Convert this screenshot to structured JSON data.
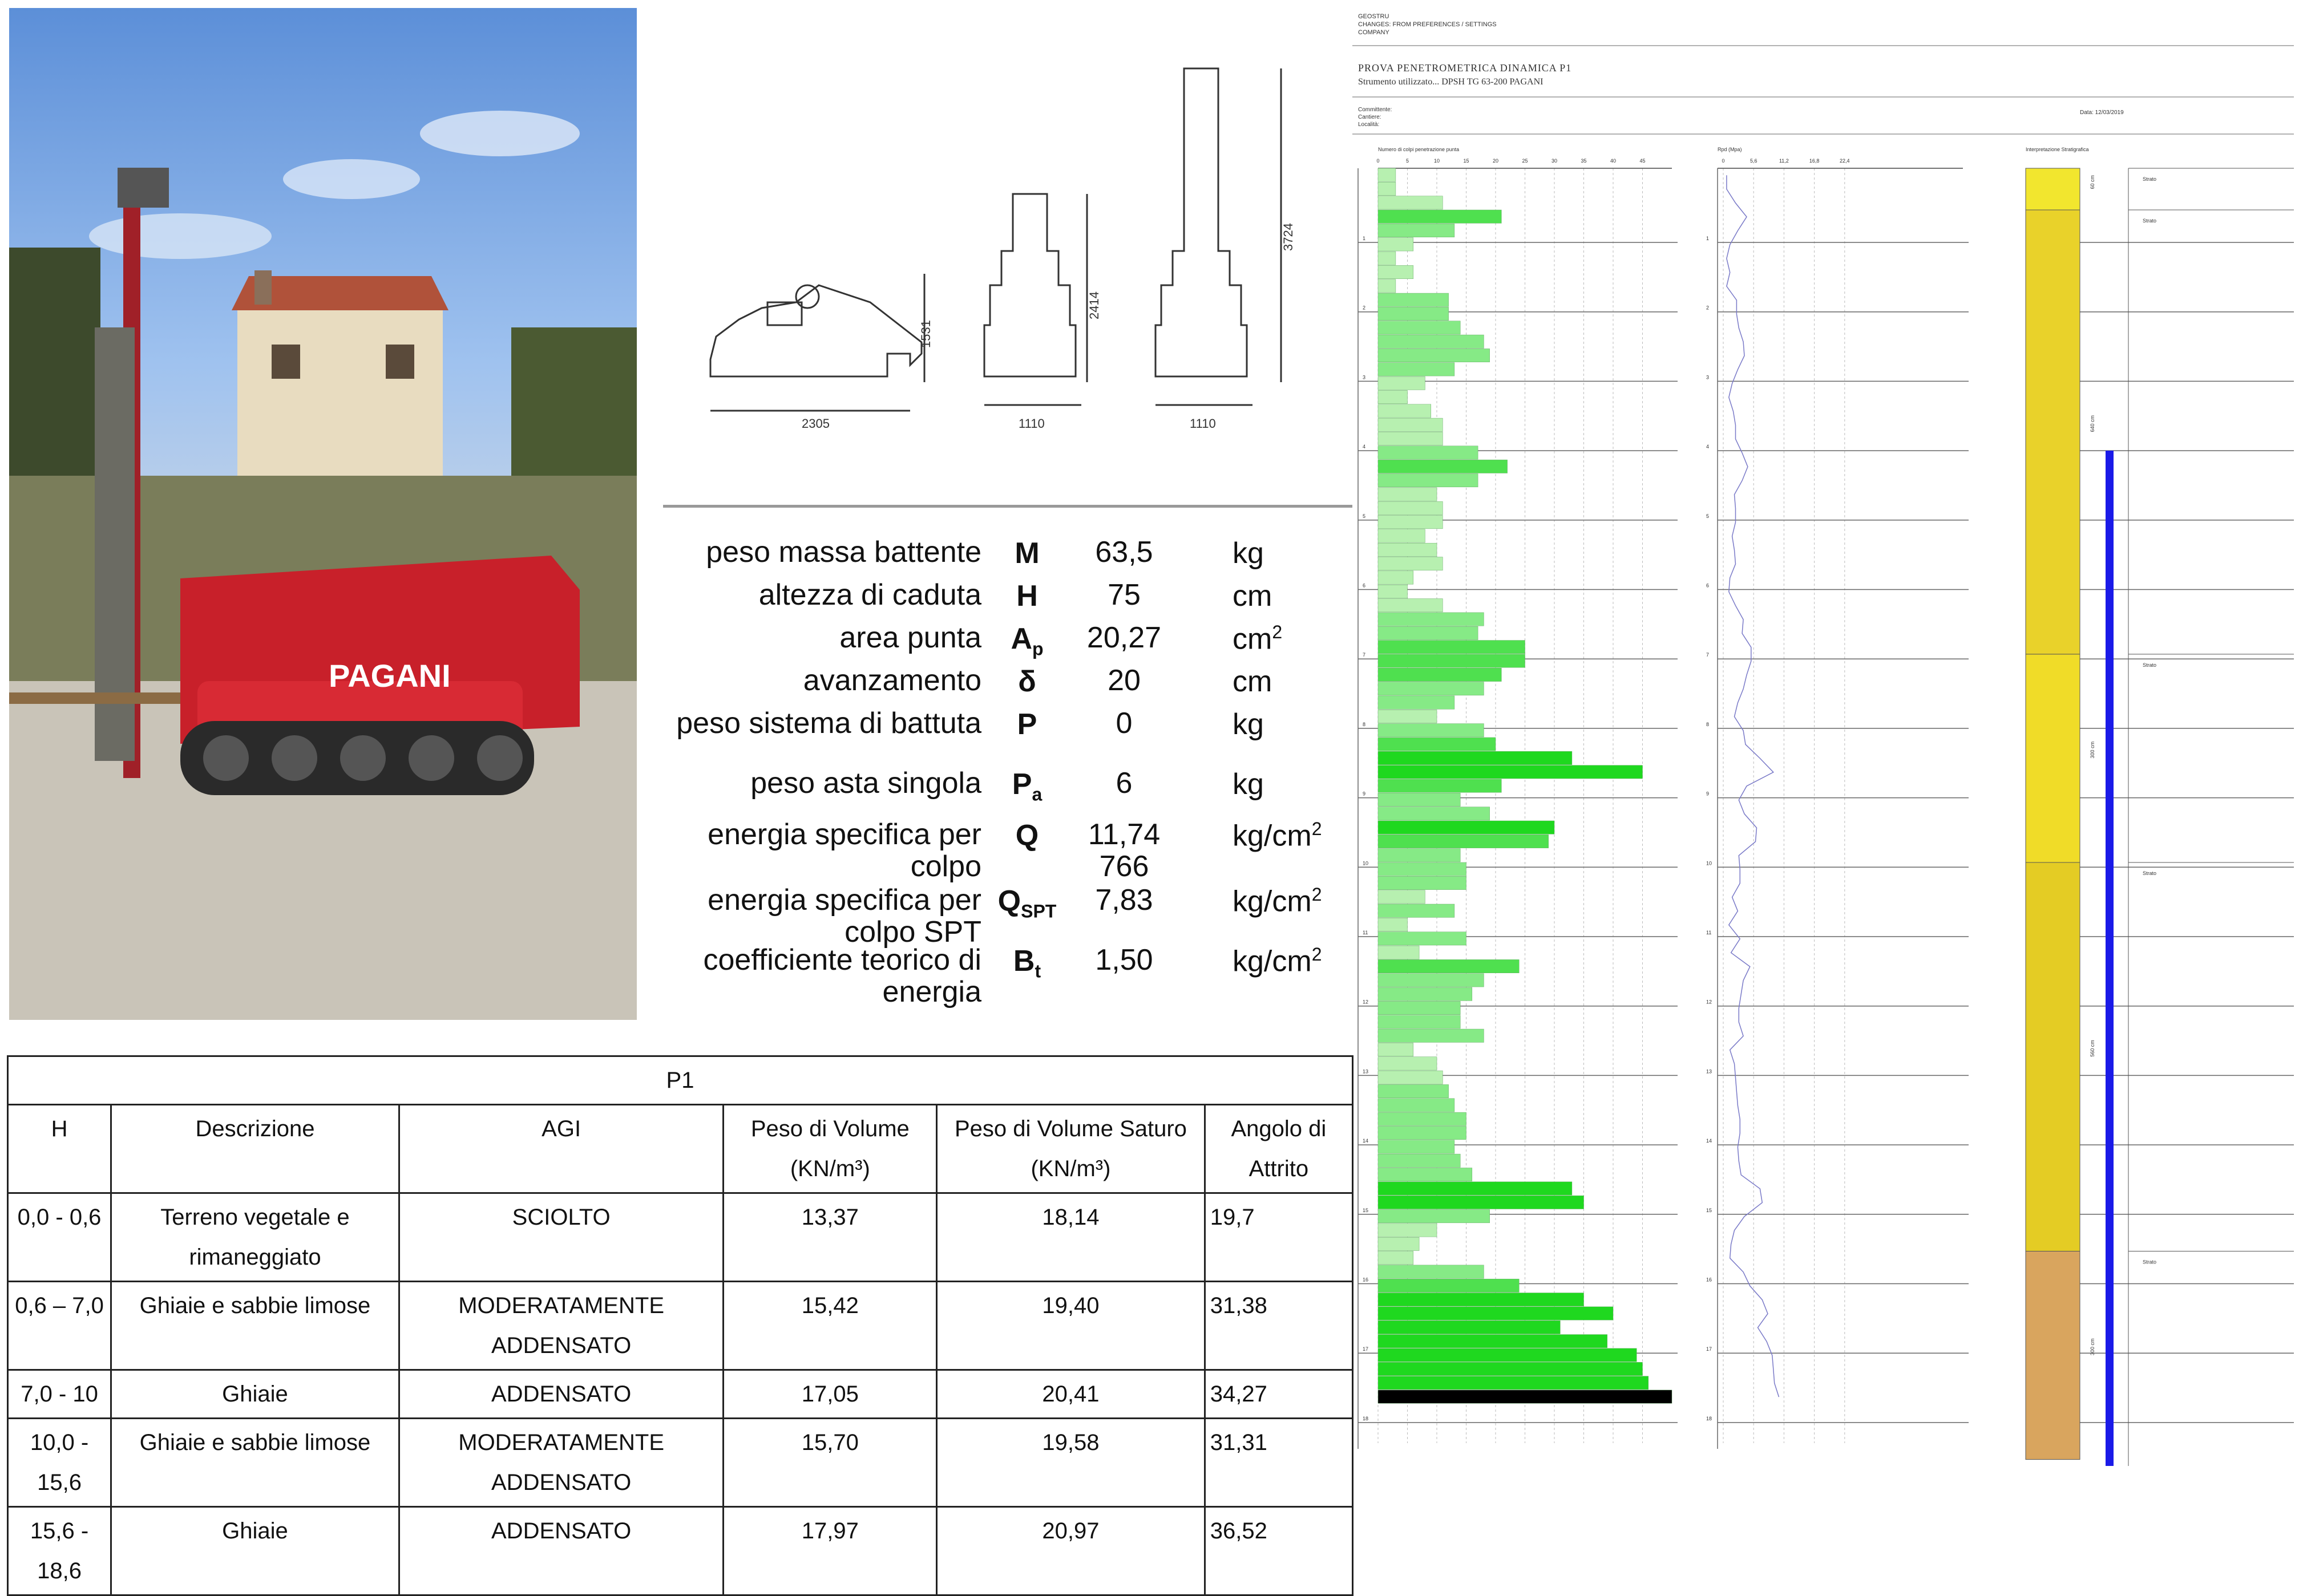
{
  "report": {
    "company_lines": [
      "GEOSTRU",
      "CHANGES: FROM PREFERENCES / SETTINGS",
      "COMPANY"
    ],
    "test_title": "PROVA PENETROMETRICA DINAMICA P1",
    "instrument": "Strumento utilizzato... DPSH TG 63-200 PAGANI",
    "client_lines": [
      "Committente:",
      "Cantiere:",
      "Località:"
    ],
    "date": "Data: 12/03/2019",
    "col1_header": "Numero di colpi penetrazione punta",
    "col2_header": "Rpd (Mpa)",
    "col3_header": "Interpretazione Stratigrafica",
    "blow_ticks": [
      "0",
      "5",
      "10",
      "15",
      "20",
      "25",
      "30",
      "35",
      "40",
      "45"
    ],
    "rpd_ticks": [
      "0",
      "5,6",
      "11,2",
      "16,8",
      "22,4"
    ],
    "depth_ticks": [
      "1",
      "2",
      "3",
      "4",
      "5",
      "6",
      "7",
      "8",
      "9",
      "10",
      "11",
      "12",
      "13",
      "14",
      "15",
      "16",
      "17",
      "18"
    ],
    "strata_label": "Strato",
    "strata_depths": [
      "60 cm",
      "640 cm",
      "300 cm",
      "560 cm",
      "300 cm"
    ]
  },
  "drawings": {
    "dims": [
      "1531",
      "2305",
      "2414",
      "1110",
      "3724",
      "1110"
    ]
  },
  "spec": {
    "rows": [
      {
        "label": "peso massa battente",
        "sym": "M",
        "val": "63,5",
        "unit": "kg"
      },
      {
        "label": "altezza di caduta",
        "sym": "H",
        "val": "75",
        "unit": "cm"
      },
      {
        "label": "area punta",
        "sym": "A",
        "sub": "p",
        "val": "20,27",
        "unit": "cm",
        "sup": "2"
      },
      {
        "label": "avanzamento",
        "sym": "δ",
        "val": "20",
        "unit": "cm"
      },
      {
        "label": "peso sistema di battuta",
        "sym": "P",
        "val": "0",
        "unit": "kg"
      },
      {
        "label": "peso asta singola",
        "sym": "P",
        "sub": "a",
        "val": "6",
        "unit": "kg"
      },
      {
        "label": "energia specifica per colpo",
        "sym": "Q",
        "val": "11,74 766",
        "unit": "kg/cm",
        "sup": "2"
      },
      {
        "label": "energia specifica per colpo SPT",
        "sym": "Q",
        "sub": "SPT",
        "val": "7,83",
        "unit": "kg/cm",
        "sup": "2"
      },
      {
        "label": "coefficiente teorico di energia",
        "sym": "B",
        "sub": "t",
        "val": "1,50",
        "unit": "kg/cm",
        "sup": "2"
      }
    ]
  },
  "table": {
    "title": "P1",
    "headers": [
      "H",
      "Descrizione",
      "AGI",
      "Peso di Volume (KN/m³)",
      "Peso di Volume Saturo (KN/m³)",
      "Angolo di Attrito"
    ],
    "rows": [
      [
        "0,0 - 0,6",
        "Terreno vegetale e rimaneggiato",
        "SCIOLTO",
        "13,37",
        "18,14",
        "19,7"
      ],
      [
        "0,6 – 7,0",
        "Ghiaie e sabbie limose",
        "MODERATAMENTE ADDENSATO",
        "15,42",
        "19,40",
        "31,38"
      ],
      [
        "7,0 - 10",
        "Ghiaie",
        "ADDENSATO",
        "17,05",
        "20,41",
        "34,27"
      ],
      [
        "10,0 - 15,6",
        "Ghiaie e sabbie limose",
        "MODERATAMENTE ADDENSATO",
        "15,70",
        "19,58",
        "31,31"
      ],
      [
        "15,6 - 18,6",
        "Ghiaie",
        "ADDENSATO",
        "17,97",
        "20,97",
        "36,52"
      ]
    ]
  },
  "photo": {
    "brand": "PAGANI"
  },
  "chart_data": {
    "type": "bar",
    "title": "",
    "xlabel": "Numero di colpi penetrazione punta",
    "ylabel": "",
    "xlim": [
      0,
      50
    ],
    "depth_step_m": 0.2,
    "values": [
      3,
      3,
      11,
      21,
      13,
      6,
      3,
      6,
      3,
      12,
      12,
      14,
      18,
      19,
      13,
      8,
      5,
      9,
      11,
      11,
      17,
      22,
      17,
      10,
      11,
      11,
      8,
      10,
      11,
      6,
      5,
      11,
      18,
      17,
      25,
      25,
      21,
      18,
      13,
      10,
      18,
      20,
      33,
      45,
      21,
      14,
      19,
      30,
      29,
      14,
      15,
      15,
      8,
      13,
      5,
      15,
      7,
      24,
      18,
      16,
      14,
      14,
      18,
      6,
      10,
      11,
      12,
      13,
      15,
      15,
      13,
      14,
      16,
      33,
      35,
      19,
      10,
      7,
      6,
      18,
      24,
      35,
      40,
      31,
      39,
      44,
      45,
      46,
      50
    ]
  }
}
